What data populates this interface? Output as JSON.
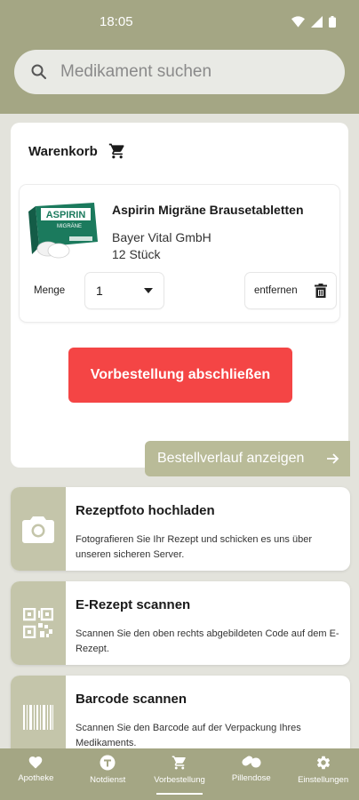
{
  "status_bar": {
    "time": "18:05"
  },
  "search": {
    "placeholder": "Medikament suchen"
  },
  "cart": {
    "title": "Warenkorb",
    "item": {
      "name": "Aspirin Migräne Brausetabletten",
      "manufacturer": "Bayer Vital GmbH",
      "package": "12 Stück",
      "image_brand": "ASPIRIN",
      "image_subtitle": "MIGRÄNE"
    },
    "quantity_label": "Menge",
    "quantity_value": "1",
    "remove_label": "entfernen",
    "checkout_label": "Vorbestellung abschließen",
    "history_label": "Bestellverlauf anzeigen"
  },
  "actions": [
    {
      "title": "Rezeptfoto hochladen",
      "description": "Fotografieren Sie Ihr Rezept und schicken es uns über unseren sicheren Server.",
      "icon": "camera-icon"
    },
    {
      "title": "E-Rezept scannen",
      "description": "Scannen Sie den oben rechts abgebildeten Code auf dem E-Rezept.",
      "icon": "qr-code-icon"
    },
    {
      "title": "Barcode scannen",
      "description": "Scannen Sie den Barcode auf der Verpackung Ihres Medikaments.",
      "icon": "barcode-icon"
    }
  ],
  "nav": [
    {
      "label": "Apotheke",
      "icon": "heart-icon"
    },
    {
      "label": "Notdienst",
      "icon": "emergency-icon"
    },
    {
      "label": "Vorbestellung",
      "icon": "cart-icon",
      "active": true
    },
    {
      "label": "Pillendose",
      "icon": "pills-icon"
    },
    {
      "label": "Einstellungen",
      "icon": "gear-icon"
    }
  ],
  "colors": {
    "brand": "#a4a684",
    "accent_red": "#f44545",
    "history_button": "#b9bb98",
    "icon_box": "#c4c5aa",
    "background": "#e3e3dc"
  }
}
